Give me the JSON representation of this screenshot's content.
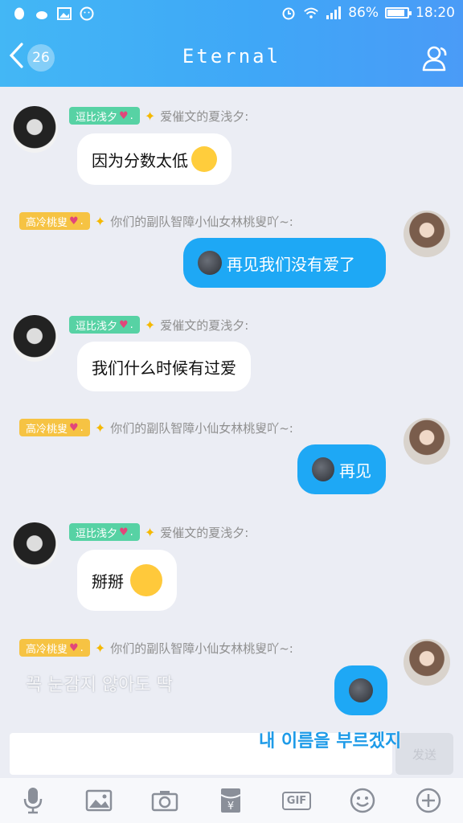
{
  "status_bar": {
    "battery_percent": "86%",
    "battery_level": 0.86,
    "time": "18:20"
  },
  "header": {
    "back_badge": "26",
    "title": "Eternal"
  },
  "messages": [
    {
      "tag": "逗比浅夕",
      "nickname": "爱催文的夏浅夕:",
      "text": "因为分数太低"
    },
    {
      "tag": "高冷桃叟",
      "nickname": "你们的副队智障小仙女林桃叟吖~:",
      "text": "再见我们没有爱了"
    },
    {
      "tag": "逗比浅夕",
      "nickname": "爱催文的夏浅夕:",
      "text": "我们什么时候有过爱"
    },
    {
      "tag": "高冷桃叟",
      "nickname": "你们的副队智障小仙女林桃叟吖~:",
      "text": "再见"
    },
    {
      "tag": "逗比浅夕",
      "nickname": "爱催文的夏浅夕:",
      "text": "掰掰"
    },
    {
      "tag": "高冷桃叟",
      "nickname": "你们的副队智障小仙女林桃叟吖~:",
      "text": ""
    }
  ],
  "overlay_text": {
    "line1": "꼭 눈감지 않아도 딱",
    "line2": "내 이름을 부르겠지"
  },
  "input": {
    "send_label": "发送"
  },
  "toolbar_icons": [
    "microphone-icon",
    "image-icon",
    "camera-icon",
    "red-packet-icon",
    "gif-icon",
    "emoji-icon",
    "plus-icon"
  ],
  "colors": {
    "header_blue": "#3fa7f7",
    "bubble_blue": "#1ea8f5",
    "tag_green": "#57d2a4",
    "tag_gold": "#f6c343"
  }
}
